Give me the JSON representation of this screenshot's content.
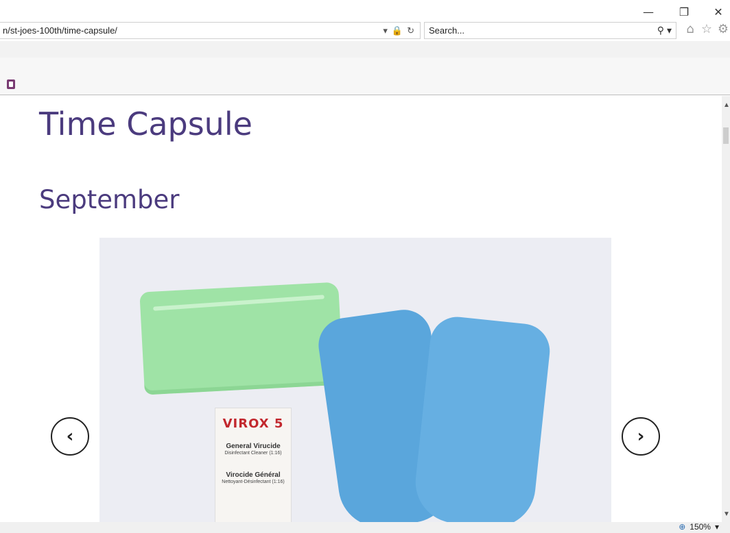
{
  "window": {
    "minimize_icon": "minimize-icon",
    "restore_icon": "restore-icon",
    "close_icon": "close-icon"
  },
  "address_bar": {
    "url": "n/st-joes-100th/time-capsule/"
  },
  "search": {
    "placeholder": "Search..."
  },
  "page": {
    "title": "Time Capsule",
    "month": "September"
  },
  "carousel": {
    "packet_brand": "VIROX 5",
    "packet_line1": "General Virucide",
    "packet_line2": "Disinfectant Cleaner (1:16)",
    "packet_line3": "Virocide Général",
    "packet_line4": "Nettoyant-Désinfectant (1:16)",
    "prev_glyph": "‹",
    "next_glyph": "›"
  },
  "status": {
    "zoom": "150%"
  }
}
